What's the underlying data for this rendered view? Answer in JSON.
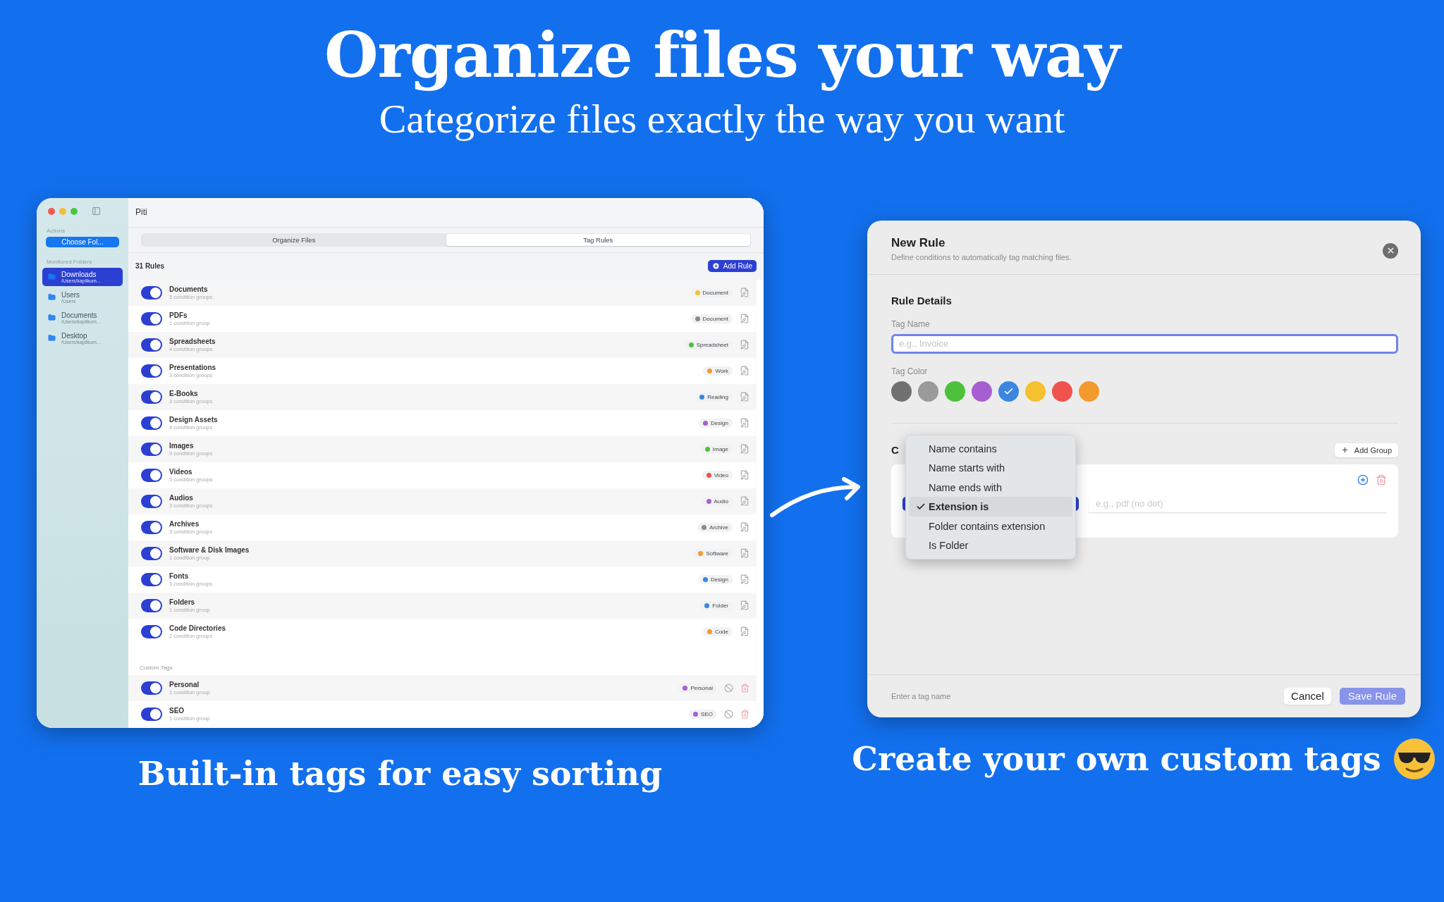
{
  "hero": {
    "title": "Organize files your way",
    "subtitle": "Categorize files exactly the way you want"
  },
  "left_window": {
    "title": "Piti",
    "sidebar": {
      "actions_label": "Actions",
      "choose_button": "Choose Fol...",
      "folders_label": "Monitored Folders",
      "folders": [
        {
          "name": "Downloads",
          "path": "/Users/kapilkum...",
          "selected": true
        },
        {
          "name": "Users",
          "path": "/Users",
          "selected": false
        },
        {
          "name": "Documents",
          "path": "/Users/kapilkum...",
          "selected": false
        },
        {
          "name": "Desktop",
          "path": "/Users/kapilkum...",
          "selected": false
        }
      ]
    },
    "tabs": [
      {
        "label": "Organize Files",
        "selected": false
      },
      {
        "label": "Tag Rules",
        "selected": true
      }
    ],
    "rules_count": "31 Rules",
    "add_rule_button": "Add Rule",
    "rules": [
      {
        "name": "Documents",
        "detail": "5 condition groups",
        "tag": "Document",
        "color": "#f5c12e",
        "enabled": true
      },
      {
        "name": "PDFs",
        "detail": "1 condition group",
        "tag": "Document",
        "color": "#8a8a8e",
        "enabled": true
      },
      {
        "name": "Spreadsheets",
        "detail": "4 condition groups",
        "tag": "Spreadsheet",
        "color": "#4cc23a",
        "enabled": true
      },
      {
        "name": "Presentations",
        "detail": "3 condition groups",
        "tag": "Work",
        "color": "#f29a2e",
        "enabled": true
      },
      {
        "name": "E-Books",
        "detail": "3 condition groups",
        "tag": "Reading",
        "color": "#3a86e0",
        "enabled": true
      },
      {
        "name": "Design Assets",
        "detail": "4 condition groups",
        "tag": "Design",
        "color": "#a65fd0",
        "enabled": true
      },
      {
        "name": "Images",
        "detail": "9 condition groups",
        "tag": "Image",
        "color": "#4cc23a",
        "enabled": true
      },
      {
        "name": "Videos",
        "detail": "3 condition groups",
        "tag": "Video",
        "color": "#f0524d",
        "enabled": true
      },
      {
        "name": "Audios",
        "detail": "3 condition groups",
        "tag": "Audio",
        "color": "#a65fd0",
        "enabled": true
      },
      {
        "name": "Archives",
        "detail": "3 condition groups",
        "tag": "Archive",
        "color": "#8a8a8e",
        "enabled": true
      },
      {
        "name": "Software & Disk Images",
        "detail": "1 condition group",
        "tag": "Software",
        "color": "#f29a2e",
        "enabled": true
      },
      {
        "name": "Fonts",
        "detail": "3 condition groups",
        "tag": "Design",
        "color": "#3a86e0",
        "enabled": true
      },
      {
        "name": "Folders",
        "detail": "1 condition group",
        "tag": "Folder",
        "color": "#3a86e0",
        "enabled": true
      },
      {
        "name": "Code Directories",
        "detail": "2 condition groups",
        "tag": "Code",
        "color": "#f29a2e",
        "enabled": true
      }
    ],
    "custom_tags_label": "Custom Tags",
    "custom_rules": [
      {
        "name": "Personal",
        "detail": "1 condition group",
        "tag": "Personal",
        "color": "#a65fd0",
        "enabled": true
      },
      {
        "name": "SEO",
        "detail": "1 condition group",
        "tag": "SEO",
        "color": "#a65fd0",
        "enabled": true
      }
    ]
  },
  "left_caption": "Built-in tags for easy sorting",
  "dialog": {
    "title": "New Rule",
    "subtitle": "Define conditions to automatically tag matching files.",
    "section_title": "Rule Details",
    "tag_name_label": "Tag Name",
    "tag_name_placeholder": "e.g., Invoice",
    "tag_color_label": "Tag Color",
    "colors": [
      {
        "color": "#707070",
        "selected": false
      },
      {
        "color": "#9a9a9a",
        "selected": false
      },
      {
        "color": "#4cc23a",
        "selected": false
      },
      {
        "color": "#a65fd0",
        "selected": false
      },
      {
        "color": "#3a86e0",
        "selected": true
      },
      {
        "color": "#f5c12e",
        "selected": false
      },
      {
        "color": "#f0524d",
        "selected": false
      },
      {
        "color": "#f29a2e",
        "selected": false
      }
    ],
    "conditions_heading": "C",
    "add_group_button": "Add Group",
    "value_placeholder": "e.g., pdf (no dot)",
    "menu": [
      {
        "label": "Name contains",
        "selected": false
      },
      {
        "label": "Name starts with",
        "selected": false
      },
      {
        "label": "Name ends with",
        "selected": false
      },
      {
        "label": "Extension is",
        "selected": true
      },
      {
        "label": "Folder contains extension",
        "selected": false
      },
      {
        "label": "Is Folder",
        "selected": false
      }
    ],
    "footer_hint": "Enter a tag name",
    "cancel_button": "Cancel",
    "save_button": {
      "label": "Save Rule",
      "disabled": true
    }
  },
  "right_caption": "Create your own custom tags"
}
